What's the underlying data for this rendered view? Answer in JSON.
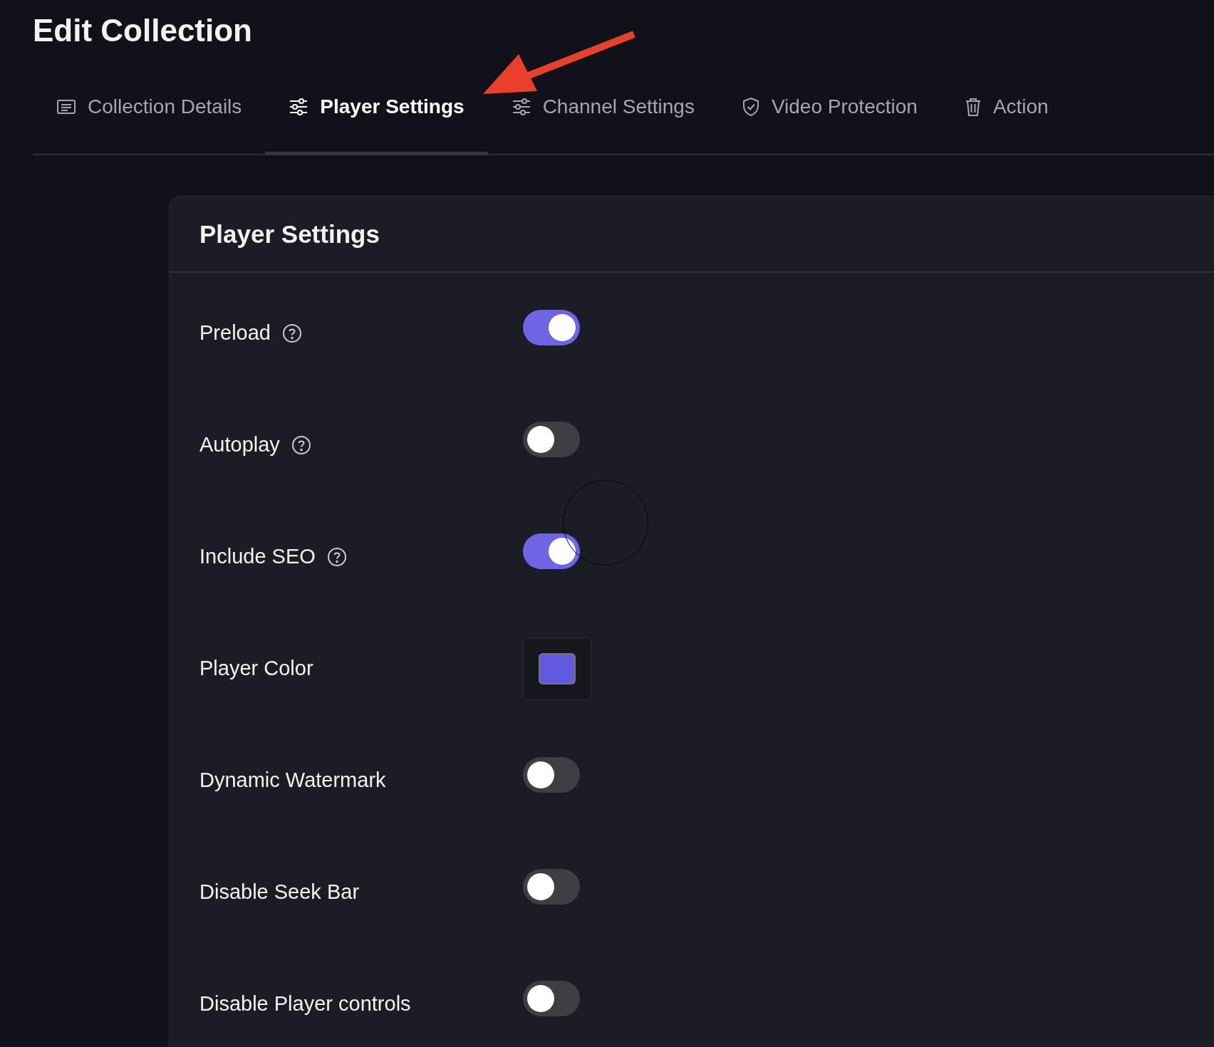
{
  "page": {
    "title": "Edit Collection"
  },
  "tabs": [
    {
      "label": "Collection Details",
      "selected": false
    },
    {
      "label": "Player Settings",
      "selected": true
    },
    {
      "label": "Channel Settings",
      "selected": false
    },
    {
      "label": "Video Protection",
      "selected": false
    },
    {
      "label": "Action",
      "selected": false
    }
  ],
  "card": {
    "title": "Player Settings",
    "rows": [
      {
        "kind": "toggle",
        "label": "Preload",
        "help": true,
        "on": true
      },
      {
        "kind": "toggle",
        "label": "Autoplay",
        "help": true,
        "on": false
      },
      {
        "kind": "toggle",
        "label": "Include SEO",
        "help": true,
        "on": true
      },
      {
        "kind": "color",
        "label": "Player Color",
        "help": false,
        "color": "#6359e0"
      },
      {
        "kind": "toggle",
        "label": "Dynamic Watermark",
        "help": false,
        "on": false
      },
      {
        "kind": "toggle",
        "label": "Disable Seek Bar",
        "help": false,
        "on": false
      },
      {
        "kind": "toggle",
        "label": "Disable Player controls",
        "help": false,
        "on": false
      }
    ]
  }
}
